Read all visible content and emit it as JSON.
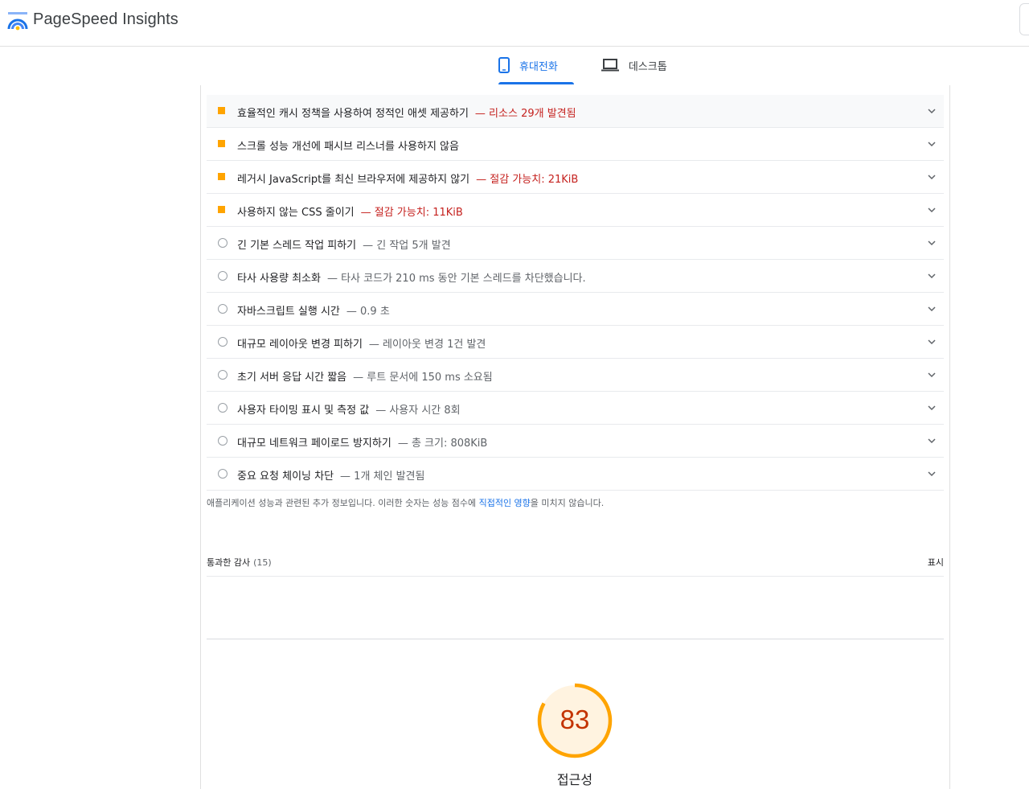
{
  "header": {
    "brand": "PageSpeed Insights"
  },
  "tabs": [
    {
      "label": "휴대전화",
      "icon": "mobile-phone-icon",
      "active": true
    },
    {
      "label": "데스크톱",
      "icon": "laptop-icon",
      "active": false
    }
  ],
  "audits": [
    {
      "title": "효율적인 캐시 정책을 사용하여 정적인 애셋 제공하기",
      "display": "— 리소스 29개 발견됨",
      "status": "warn"
    },
    {
      "title": "스크롤 성능 개선에 패시브 리스너를 사용하지 않음",
      "display": "",
      "status": "warn"
    },
    {
      "title": "레거시 JavaScript를 최신 브라우저에 제공하지 않기",
      "display": "— 절감 가능치: 21KiB",
      "status": "warn"
    },
    {
      "title": "사용하지 않는 CSS 줄이기",
      "display": "— 절감 가능치: 11KiB",
      "status": "warn"
    },
    {
      "title": "긴 기본 스레드 작업 피하기",
      "display": "— 긴 작업 5개 발견",
      "status": "info"
    },
    {
      "title": "타사 사용량 최소화",
      "display": "— 타사 코드가 210 ms 동안 기본 스레드를 차단했습니다.",
      "status": "info"
    },
    {
      "title": "자바스크립트 실행 시간",
      "display": "— 0.9 초",
      "status": "info"
    },
    {
      "title": "대규모 레이아웃 변경 피하기",
      "display": "— 레이아웃 변경 1건 발견",
      "status": "info"
    },
    {
      "title": "초기 서버 응답 시간 짧음",
      "display": "— 루트 문서에 150 ms 소요됨",
      "status": "info"
    },
    {
      "title": "사용자 타이밍 표시 및 측정 값",
      "display": "— 사용자 시간 8회",
      "status": "info"
    },
    {
      "title": "대규모 네트워크 페이로드 방지하기",
      "display": "— 총 크기: 808KiB",
      "status": "info"
    },
    {
      "title": "중요 요청 체이닝 차단",
      "display": "— 1개 체인 발견됨",
      "status": "info"
    }
  ],
  "note": {
    "before": "애플리케이션 성능과 관련된 추가 정보입니다. 이러한 숫자는 성능 점수에 ",
    "link": "직접적인 영향",
    "after": "을 미치지 않습니다."
  },
  "passed": {
    "label": "통과한 감사",
    "count": "(15)",
    "show": "표시"
  },
  "score": {
    "value": "83",
    "fraction": 0.83,
    "label": "접근성",
    "color": "#ffa400",
    "text_color": "#c33300",
    "bg_color": "#fff3e0"
  },
  "colors": {
    "warn": "#ffa400",
    "warn_text": "#c5221f",
    "accent": "#1a73e8"
  }
}
